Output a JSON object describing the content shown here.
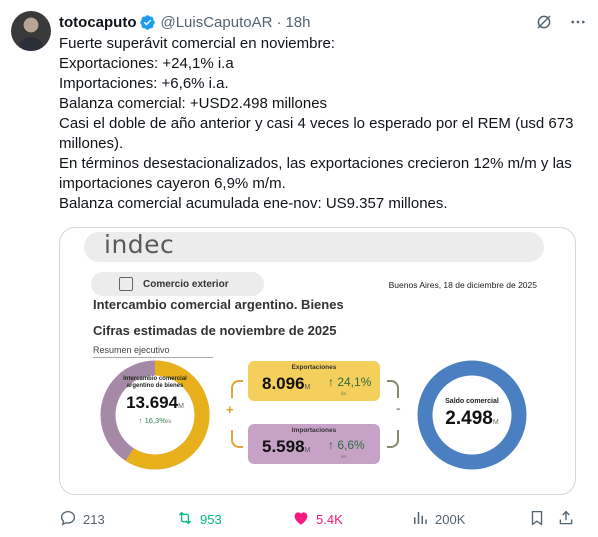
{
  "tweet": {
    "display_name": "totocaputo",
    "handle": "@LuisCaputoAR",
    "separator": "·",
    "time": "18h",
    "lines": [
      "Fuerte superávit comercial en noviembre:",
      "Exportaciones: +24,1% i.a",
      "Importaciones: +6,6% i.a.",
      "Balanza comercial: +USD2.498 millones",
      "Casi el doble de año anterior y casi 4 veces lo esperado por el REM (usd 673 millones).",
      "En términos desestacionalizados,  las exportaciones crecieron 12% m/m y las importaciones cayeron 6,9% m/m.",
      "Balanza comercial acumulada ene-nov: US9.357 millones."
    ]
  },
  "card": {
    "logo": "indec",
    "section_pill": "Comercio exterior",
    "date": "Buenos Aires, 18 de diciembre de 2025",
    "title_1": "Intercambio comercial argentino. Bienes",
    "title_2": "Cifras estimadas de noviembre de 2025",
    "subtitle": "Resumen ejecutivo",
    "intercambio": {
      "label": "Intercambio comercial argentino de bienes",
      "value": "13.694",
      "unit": "M",
      "variation": "↑ 16,3%",
      "variation_sub": "i/a",
      "share_exports": 0.59,
      "color_exports": "#e8b11b",
      "color_imports": "#a689a6"
    },
    "exportaciones": {
      "label": "Exportaciones",
      "value": "8.096",
      "unit": "M",
      "variation": "↑ 24,1%",
      "variation_sub": "i/a",
      "color": "#f4cf5b"
    },
    "importaciones": {
      "label": "Importaciones",
      "value": "5.598",
      "unit": "M",
      "variation": "↑ 6,6%",
      "variation_sub": "i/a",
      "color": "#c6a3c6"
    },
    "saldo": {
      "label": "Saldo comercial",
      "value": "2.498",
      "unit": "M",
      "color": "#4a7fc1"
    },
    "plus_sign": "+",
    "minus_sign": "-"
  },
  "actions": {
    "replies": "213",
    "retweets": "953",
    "likes": "5.4K",
    "views": "200K"
  },
  "icons": [
    "verified-badge-icon",
    "grok-icon",
    "more-icon",
    "reply-icon",
    "retweet-icon",
    "like-icon",
    "views-icon",
    "bookmark-icon",
    "share-icon"
  ],
  "colors": {
    "verified": "#1d9bf0",
    "retweet_active": "#00ba7c",
    "like_active": "#f91880",
    "muted": "#536471"
  }
}
